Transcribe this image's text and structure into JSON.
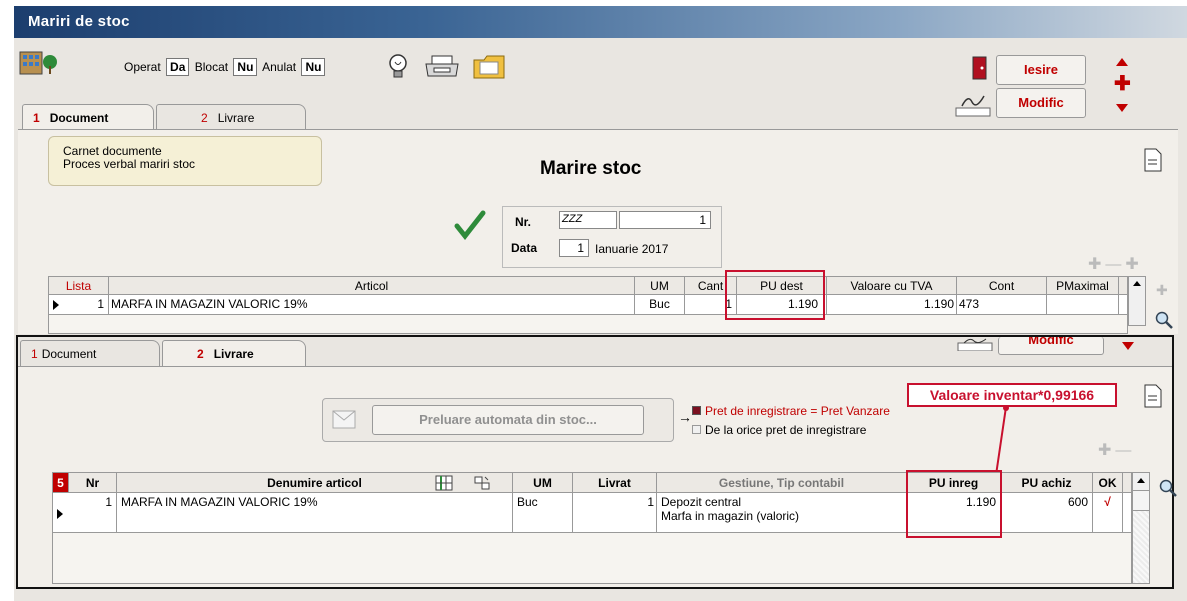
{
  "window": {
    "title": "Mariri de stoc"
  },
  "status": {
    "operat_label": "Operat",
    "operat_value": "Da",
    "blocat_label": "Blocat",
    "blocat_value": "Nu",
    "anulat_label": "Anulat",
    "anulat_value": "Nu"
  },
  "buttons": {
    "iesire": "Iesire",
    "modific": "Modific",
    "modific_lower": "Modific"
  },
  "top_tabs": [
    {
      "num": "1",
      "label": "Document"
    },
    {
      "num": "2",
      "label": "Livrare"
    }
  ],
  "carnet": {
    "label": "Carnet documente",
    "value": "Proces verbal mariri stoc"
  },
  "doc": {
    "heading": "Marire stoc",
    "nr_label": "Nr.",
    "nr_series": "ZZZ",
    "nr_value": "1",
    "data_label": "Data",
    "data_day": "1",
    "data_month_year": "Ianuarie 2017"
  },
  "grid1": {
    "headers": [
      "Lista",
      "Articol",
      "UM",
      "Cant",
      "PU dest",
      "Valoare cu TVA",
      "Cont",
      "PMaximal"
    ],
    "rows": [
      {
        "lista": "1",
        "articol": "MARFA IN MAGAZIN VALORIC 19%",
        "um": "Buc",
        "cant": "1",
        "pu_dest": "1.190",
        "valoare": "1.190",
        "cont": "473",
        "pmaximal": ""
      }
    ]
  },
  "bottom_tabs": [
    {
      "num": "1",
      "label": "Document"
    },
    {
      "num": "2",
      "label": "Livrare"
    }
  ],
  "preluare": {
    "button_label": "Preluare automata din stoc...",
    "option1": "Pret de inregistrare = Pret Vanzare",
    "option2": "De la orice pret de inregistrare"
  },
  "annotation": "Valoare inventar*0,99166",
  "grid2": {
    "count": "5",
    "headers": [
      "Nr",
      "Denumire articol",
      "UM",
      "Livrat",
      "Gestiune, Tip contabil",
      "PU inreg",
      "PU achiz",
      "OK"
    ],
    "rows": [
      {
        "nr": "1",
        "denumire": "MARFA IN MAGAZIN VALORIC 19%",
        "um": "Buc",
        "livrat": "1",
        "gestiune": "Depozit central",
        "tip": "Marfa in magazin (valoric)",
        "pu_inreg": "1.190",
        "pu_achiz": "600",
        "ok": "√"
      }
    ]
  },
  "colors": {
    "accent_red": "#c8102e",
    "title_blue": "#1c3e6e"
  }
}
